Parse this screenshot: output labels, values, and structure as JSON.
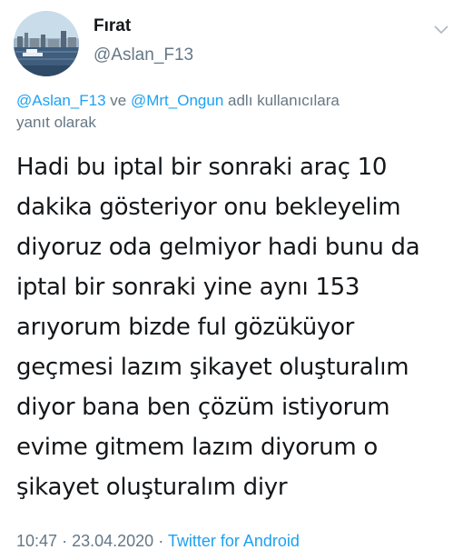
{
  "tweet": {
    "display_name": "Fırat",
    "handle": "@Aslan_F13",
    "reply": {
      "mention_1": "@Aslan_F13",
      "connector": "ve",
      "mention_2": "@Mrt_Ongun",
      "suffix_line1": "adlı kullanıcılara",
      "suffix_line2": "yanıt olarak"
    },
    "text_lines": [
      "Hadi bu iptal bir sonraki araç 10",
      "dakika gösteriyor onu bekleyelim",
      "diyoruz oda gelmiyor hadi bunu da",
      "iptal bir sonraki yine aynı 153",
      "arıyorum bizde ful gözüküyor",
      "geçmesi lazım şikayet oluşturalım",
      "diyor bana ben çözüm istiyorum",
      "evime gitmem lazım diyorum o",
      "şikayet oluşturalım diyr"
    ],
    "time": "10:47",
    "separator": "·",
    "date": "23.04.2020",
    "source": "Twitter for Android"
  },
  "icons": {
    "menu": "chevron-down-icon",
    "avatar": "avatar-photo"
  },
  "colors": {
    "text": "#14171a",
    "secondary": "#657786",
    "link": "#1da1f2"
  }
}
